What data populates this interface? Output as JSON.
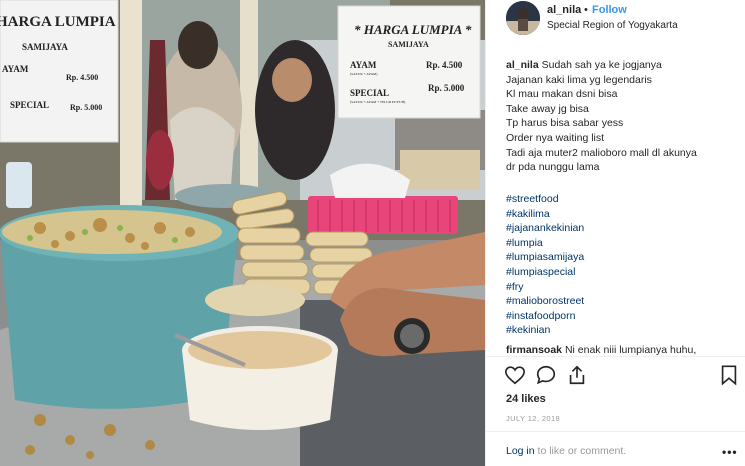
{
  "photo": {
    "left_sign": {
      "title": "HARGA LUMPIA",
      "subtitle": "SAMIJAYA",
      "row1_name": "AYAM",
      "row1_price": "Rp. 4.500",
      "row2_name": "SPECIAL",
      "row2_price": "Rp. 5.000"
    },
    "right_sign": {
      "title": "* HARGA LUMPIA *",
      "subtitle": "SAMIJAYA",
      "row1_name": "AYAM",
      "row1_desc": "(SAYUR + AYAM)",
      "row1_price": "Rp. 4.500",
      "row2_name": "SPECIAL",
      "row2_desc": "(SAYUR + AYAM + TELUR PUYUH)",
      "row2_price": "Rp. 5.000"
    }
  },
  "header": {
    "username": "al_nila",
    "separator": "•",
    "follow_label": "Follow",
    "location": "Special Region of Yogyakarta"
  },
  "caption": {
    "username": "al_nila",
    "lines": [
      "Sudah sah ya ke jogjanya",
      "Jajanan kaki lima yg legendaris",
      "Kl mau makan dsni bisa",
      "Take away jg bisa",
      "Tp harus bisa sabar yess",
      "Order nya waiting list",
      "Tadi aja muter2 malioboro mall dl akunya",
      "dr pda nunggu lama"
    ],
    "hashtags": [
      "#streetfood",
      "#kakilima",
      "#jajanankekinian",
      "#lumpia",
      "#lumpiasamijaya",
      "#lumpiaspecial",
      "#fry",
      "#malioborostreet",
      "#instafoodporn",
      "#kekinian"
    ]
  },
  "comment": {
    "username": "firmansoak",
    "text": "Ni enak niii lumpianya huhu,"
  },
  "actions": {
    "like_icon": "heart-icon",
    "comment_icon": "speech-bubble-icon",
    "share_icon": "share-icon",
    "save_icon": "bookmark-icon"
  },
  "likes": "24 likes",
  "date": "JULY 12, 2018",
  "footer": {
    "login_link": "Log in",
    "login_text": " to like or comment.",
    "more_label": "•••"
  },
  "colors": {
    "link_blue": "#3897f0",
    "hashtag_navy": "#003569",
    "basin_teal": "#5fa3a8",
    "basket_pink": "#e8457a"
  }
}
